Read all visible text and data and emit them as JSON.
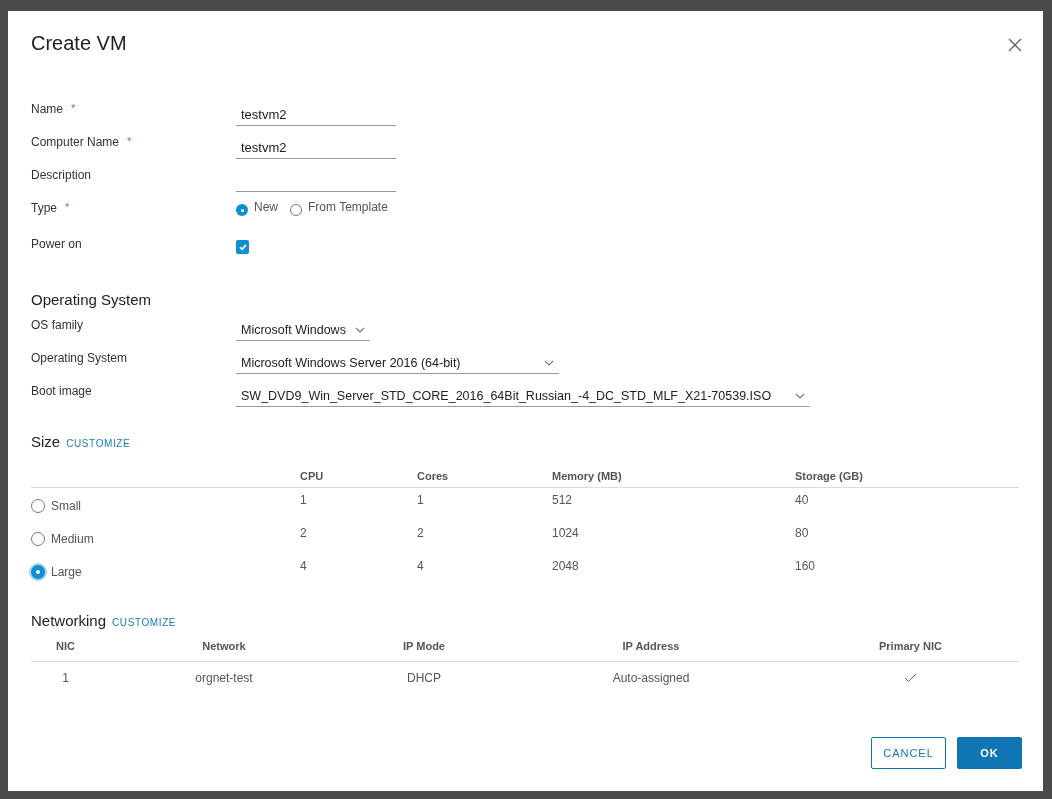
{
  "dialog": {
    "title": "Create VM"
  },
  "form": [
    {
      "kind": "text",
      "label": "Name",
      "required_mark": "*",
      "value": "testvm2"
    },
    {
      "kind": "text",
      "label": "Computer Name",
      "required_mark": "*",
      "value": "testvm2"
    },
    {
      "kind": "text",
      "label": "Description"
    },
    {
      "kind": "radio",
      "label": "Type",
      "required_mark": "*",
      "options": [
        {
          "label": "New",
          "selected": true
        },
        {
          "label": "From Template",
          "selected": false
        }
      ]
    },
    {
      "kind": "checkbox",
      "label": "Power on",
      "checked": true
    }
  ],
  "operating_system": {
    "heading": "Operating System",
    "fields": [
      {
        "label": "OS family",
        "value": "Microsoft Windows"
      },
      {
        "label": "Operating System",
        "value": "Microsoft Windows Server 2016 (64-bit)"
      },
      {
        "label": "Boot image",
        "value": "SW_DVD9_Win_Server_STD_CORE_2016_64Bit_Russian_-4_DC_STD_MLF_X21-70539.ISO"
      }
    ]
  },
  "size": {
    "heading": "Size",
    "link": "CUSTOMIZE",
    "columns": [
      "CPU",
      "Cores",
      "Memory (MB)",
      "Storage (GB)"
    ],
    "rows": [
      {
        "label": "Small",
        "selected": false,
        "cells": [
          "1",
          "1",
          "512",
          "40"
        ]
      },
      {
        "label": "Medium",
        "selected": false,
        "cells": [
          "2",
          "2",
          "1024",
          "80"
        ]
      },
      {
        "label": "Large",
        "selected": true,
        "cells": [
          "4",
          "4",
          "2048",
          "160"
        ]
      }
    ]
  },
  "networking": {
    "heading": "Networking",
    "link": "CUSTOMIZE",
    "columns": [
      "NIC",
      "Network",
      "IP Mode",
      "IP Address",
      "Primary NIC"
    ],
    "rows": [
      {
        "nic": "1",
        "network": "orgnet-test",
        "ip_mode": "DHCP",
        "ip_address": "Auto-assigned",
        "primary": true
      }
    ]
  },
  "buttons": [
    {
      "label": "CANCEL",
      "kind": "secondary"
    },
    {
      "label": "OK",
      "kind": "primary"
    }
  ]
}
